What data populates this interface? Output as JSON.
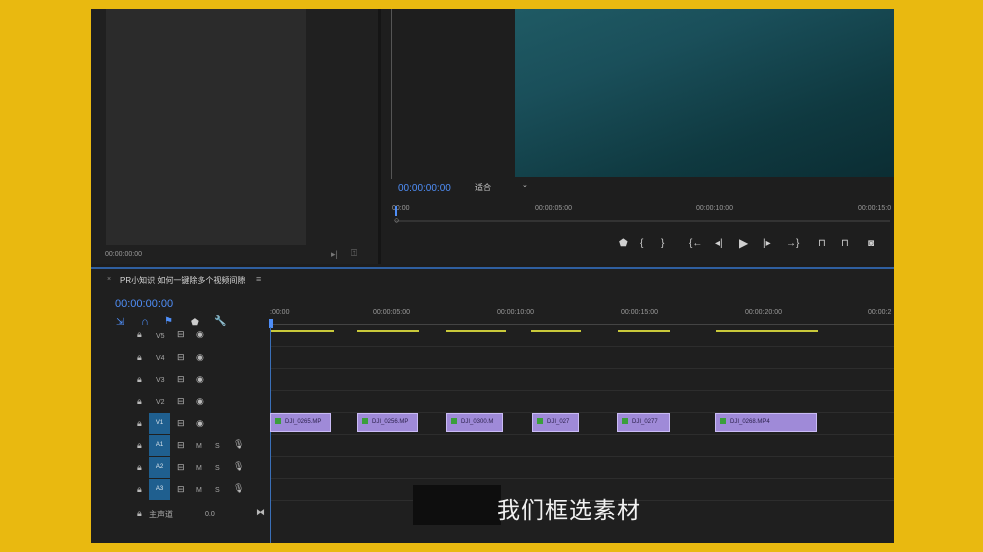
{
  "source_panel": {
    "timecode": "00:00:00:00"
  },
  "program_monitor": {
    "timecode": "00:00:00:00",
    "fit_select": "适合",
    "ruler_ticks": [
      "00:00",
      "00:00:05:00",
      "00:00:10:00",
      "00:00:15:0"
    ],
    "controls": [
      "marker-icon",
      "in-point-icon",
      "out-point-icon",
      "go-to-in-icon",
      "step-back-icon",
      "play-icon",
      "step-forward-icon",
      "go-to-out-icon",
      "lift-icon",
      "extract-icon",
      "export-frame-icon"
    ]
  },
  "timeline": {
    "tab_title": "PR小知识 如何一键除多个视频间隙",
    "timecode": "00:00:00:00",
    "ruler_ticks": [
      ":00:00",
      "00:00:05:00",
      "00:00:10:00",
      "00:00:15:00",
      "00:00:20:00",
      "00:00:2"
    ],
    "tracks": {
      "v5": "V5",
      "v4": "V4",
      "v3": "V3",
      "v2": "V2",
      "v1": "V1",
      "a1": "A1",
      "a2": "A2",
      "a3": "A3",
      "m": "M",
      "s": "S",
      "master": "主声道",
      "master_value": "0.0"
    },
    "clips": [
      "DJI_0265.MP",
      "DJI_0256.MP",
      "DJI_0300.M",
      "DJI_027",
      "DJI_0277",
      "DJI_0268.MP4"
    ]
  },
  "subtitle": "我们框选素材"
}
